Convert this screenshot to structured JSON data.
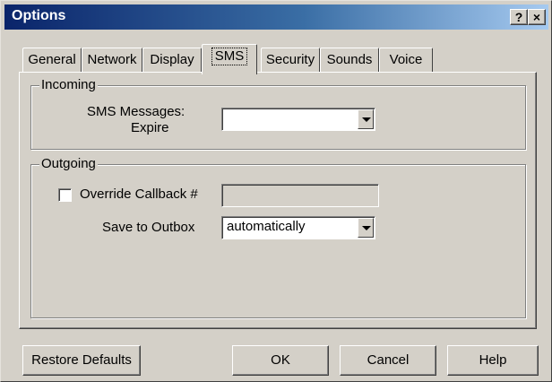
{
  "window": {
    "title": "Options",
    "help_glyph": "?",
    "close_glyph": "×"
  },
  "tabs": [
    {
      "label": "General",
      "active": false
    },
    {
      "label": "Network",
      "active": false
    },
    {
      "label": "Display",
      "active": false
    },
    {
      "label": "SMS",
      "active": true
    },
    {
      "label": "Security",
      "active": false
    },
    {
      "label": "Sounds",
      "active": false
    },
    {
      "label": "Voice",
      "active": false
    }
  ],
  "incoming": {
    "legend": "Incoming",
    "sms_label_line1": "SMS Messages:",
    "sms_label_line2": "Expire",
    "expire_value": ""
  },
  "outgoing": {
    "legend": "Outgoing",
    "override_label": "Override Callback #",
    "override_checked": false,
    "callback_value": "",
    "save_label": "Save to Outbox",
    "save_value": "automatically"
  },
  "buttons": {
    "restore": "Restore Defaults",
    "ok": "OK",
    "cancel": "Cancel",
    "help": "Help"
  },
  "colors": {
    "title_start": "#0a246a",
    "title_end": "#a6caf0",
    "face": "#d4d0c8"
  }
}
